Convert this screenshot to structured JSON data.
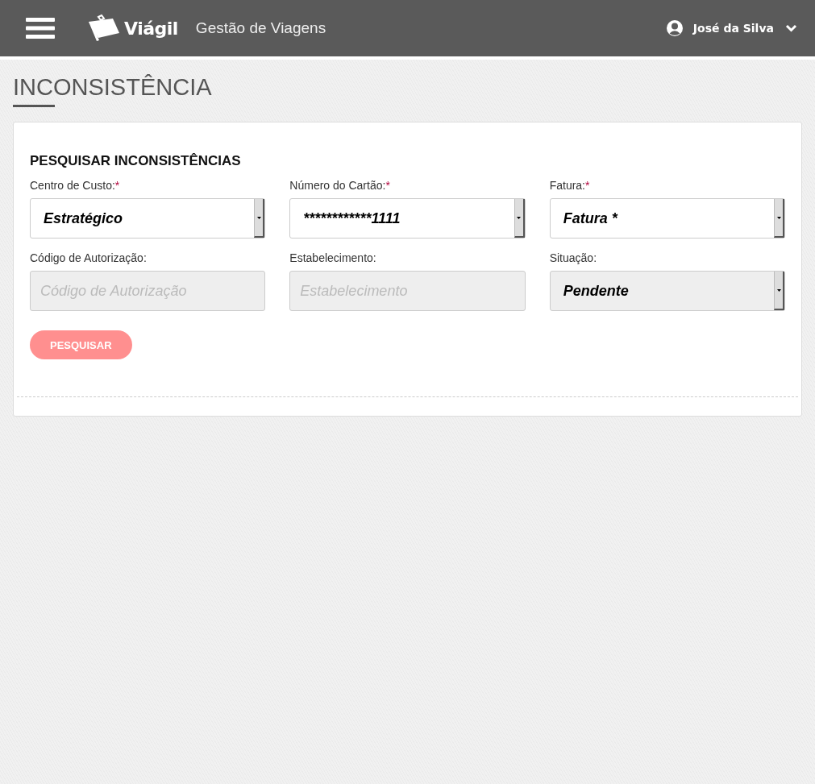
{
  "header": {
    "brand": "Viágil",
    "subtitle": "Gestão de Viagens",
    "user": "José da Silva"
  },
  "page_title": "INCONSISTÊNCIA",
  "search_panel": {
    "title": "PESQUISAR INCONSISTÊNCIAS",
    "fields": [
      {
        "kind": "select",
        "label": "Centro de Custo:",
        "required_mark": "*",
        "value": "Estratégico",
        "disabled": false
      },
      {
        "kind": "select",
        "label": "Número do Cartão:",
        "required_mark": "*",
        "value": "************1111",
        "disabled": false
      },
      {
        "kind": "select",
        "label": "Fatura:",
        "required_mark": "*",
        "value": "Fatura *",
        "disabled": false
      },
      {
        "kind": "input",
        "label": "Código de Autorização:",
        "placeholder": "Código de Autorização",
        "disabled": true
      },
      {
        "kind": "input",
        "label": "Estabelecimento:",
        "placeholder": "Estabelecimento",
        "disabled": true
      },
      {
        "kind": "select",
        "label": "Situação:",
        "value": "Pendente",
        "disabled": true
      }
    ],
    "button": {
      "label": "PESQUISAR",
      "disabled": true
    }
  }
}
